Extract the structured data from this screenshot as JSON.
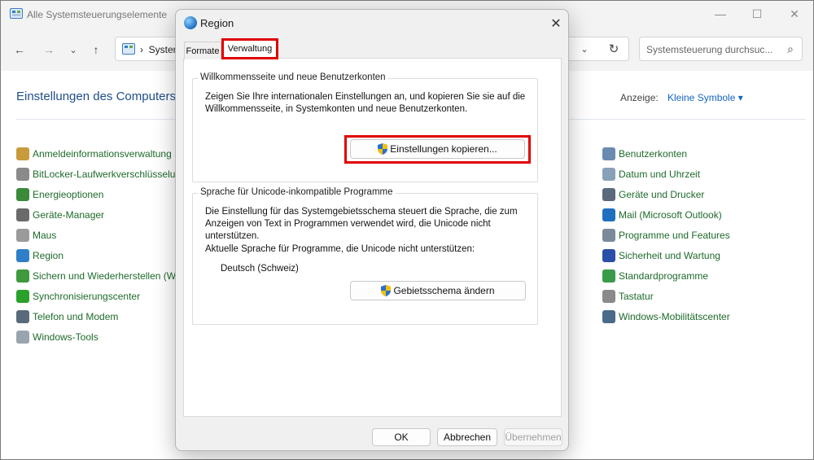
{
  "window": {
    "title": "Alle Systemsteuerungselemente",
    "address_text": "Syster",
    "search_placeholder": "Systemsteuerung durchsuc...",
    "heading": "Einstellungen des Computers",
    "view_label": "Anzeige:",
    "view_value": "Kleine Symbole ▾",
    "left_items": [
      {
        "label": "Anmeldeinformationsverwaltung",
        "icon": "credential-icon",
        "color": "#c89b3c"
      },
      {
        "label": "BitLocker-Laufwerkverschlüsselun",
        "icon": "bitlocker-icon",
        "color": "#8a8a8a"
      },
      {
        "label": "Energieoptionen",
        "icon": "power-icon",
        "color": "#3a8a3a"
      },
      {
        "label": "Geräte-Manager",
        "icon": "device-manager-icon",
        "color": "#6a6a6a"
      },
      {
        "label": "Maus",
        "icon": "mouse-icon",
        "color": "#9a9a9a"
      },
      {
        "label": "Region",
        "icon": "region-icon",
        "color": "#2f7fc8"
      },
      {
        "label": "Sichern und Wiederherstellen (Wi",
        "icon": "backup-icon",
        "color": "#3f9a3f"
      },
      {
        "label": "Synchronisierungscenter",
        "icon": "sync-icon",
        "color": "#2aa12a"
      },
      {
        "label": "Telefon und Modem",
        "icon": "phone-icon",
        "color": "#5a6a7a"
      },
      {
        "label": "Windows-Tools",
        "icon": "tools-icon",
        "color": "#9aa4ae"
      }
    ],
    "right_items": [
      {
        "label": "Benutzerkonten",
        "icon": "user-accounts-icon",
        "color": "#6a8ab0"
      },
      {
        "label": "Datum und Uhrzeit",
        "icon": "clock-icon",
        "color": "#8aa0b8"
      },
      {
        "label": "Geräte und Drucker",
        "icon": "printer-icon",
        "color": "#5a6a7a"
      },
      {
        "label": "Mail (Microsoft Outlook)",
        "icon": "mail-icon",
        "color": "#1f6fc0"
      },
      {
        "label": "Programme und Features",
        "icon": "programs-icon",
        "color": "#7a8a9a"
      },
      {
        "label": "Sicherheit und Wartung",
        "icon": "flag-icon",
        "color": "#2a4fa8"
      },
      {
        "label": "Standardprogramme",
        "icon": "default-programs-icon",
        "color": "#3a9a4a"
      },
      {
        "label": "Tastatur",
        "icon": "keyboard-icon",
        "color": "#8a8a8a"
      },
      {
        "label": "Windows-Mobilitätscenter",
        "icon": "mobility-icon",
        "color": "#4a6a8a"
      }
    ]
  },
  "dialog": {
    "title": "Region",
    "tabs": [
      "Formate",
      "Verwaltung"
    ],
    "group1": {
      "title": "Willkommensseite und neue Benutzerkonten",
      "text": "Zeigen Sie Ihre internationalen Einstellungen an, und kopieren Sie sie auf die Willkommensseite, in Systemkonten und neue Benutzerkonten.",
      "button": "Einstellungen kopieren..."
    },
    "group2": {
      "title": "Sprache für Unicode-inkompatible Programme",
      "text": "Die Einstellung für das Systemgebietsschema steuert die Sprache, die zum Anzeigen von Text in Programmen verwendet wird, die Unicode nicht unterstützen.",
      "current_label": "Aktuelle Sprache für Programme, die Unicode nicht unterstützen:",
      "current_value": "Deutsch (Schweiz)",
      "button": "Gebietsschema ändern"
    },
    "footer": {
      "ok": "OK",
      "cancel": "Abbrechen",
      "apply": "Übernehmen"
    }
  },
  "colors": {
    "highlight": "#e00000",
    "link_green": "#1e6a2b",
    "heading_blue": "#1e4e8c"
  }
}
